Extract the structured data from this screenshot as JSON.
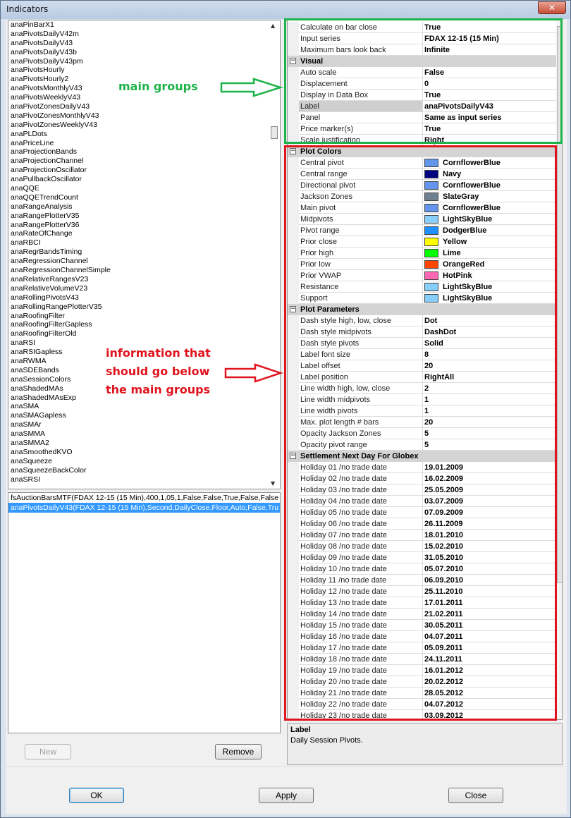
{
  "window": {
    "title": "Indicators",
    "close_glyph": "✕"
  },
  "indicator_list": [
    "anaPinBarX1",
    "anaPivotsDailyV42m",
    "anaPivotsDailyV43",
    "anaPivotsDailyV43b",
    "anaPivotsDailyV43pm",
    "anaPivotsHourly",
    "anaPivotsHourly2",
    "anaPivotsMonthlyV43",
    "anaPivotsWeeklyV43",
    "anaPivotZonesDailyV43",
    "anaPivotZonesMonthlyV43",
    "anaPivotZonesWeeklyV43",
    "anaPLDots",
    "anaPriceLine",
    "anaProjectionBands",
    "anaProjectionChannel",
    "anaProjectionOscillator",
    "anaPullbackOscillator",
    "anaQQE",
    "anaQQETrendCount",
    "anaRangeAnalysis",
    "anaRangePlotterV35",
    "anaRangePlotterV36",
    "anaRateOfChange",
    "anaRBCI",
    "anaRegrBandsTiming",
    "anaRegressionChannel",
    "anaRegressionChannelSimple",
    "anaRelativeRangesV23",
    "anaRelativeVolumeV23",
    "anaRollingPivotsV43",
    "anaRollingRangePlotterV35",
    "anaRoofingFilter",
    "anaRoofingFilterGapless",
    "anaRoofingFilterOld",
    "anaRSI",
    "anaRSIGapless",
    "anaRWMA",
    "anaSDEBands",
    "anaSessionColors",
    "anaShadedMAs",
    "anaShadedMAsExp",
    "anaSMA",
    "anaSMAGapless",
    "anaSMAr",
    "anaSMMA",
    "anaSMMA2",
    "anaSmoothedKVO",
    "anaSqueeze",
    "anaSqueezeBackColor",
    "anaSRSI"
  ],
  "applied_list": [
    {
      "text": "fsAuctionBarsMTF(FDAX 12-15 (15 Min),400,1,05,1,False,False,True,False,False",
      "selected": false
    },
    {
      "text": "anaPivotsDailyV43(FDAX 12-15 (15 Min),Second,DailyClose,Floor,Auto,False,Tru",
      "selected": true
    }
  ],
  "buttons": {
    "new": "New",
    "remove": "Remove",
    "ok": "OK",
    "apply": "Apply",
    "close": "Close"
  },
  "grid": [
    {
      "name": "Calculate on bar close",
      "value": "True"
    },
    {
      "name": "Input series",
      "value": "FDAX 12-15 (15 Min)"
    },
    {
      "name": "Maximum bars look back",
      "value": "Infinite"
    },
    {
      "category": "Visual"
    },
    {
      "name": "Auto scale",
      "value": "False"
    },
    {
      "name": "Displacement",
      "value": "0"
    },
    {
      "name": "Display in Data Box",
      "value": "True"
    },
    {
      "name": "Label",
      "value": "anaPivotsDailyV43",
      "selected": true
    },
    {
      "name": "Panel",
      "value": "Same as input series"
    },
    {
      "name": "Price marker(s)",
      "value": "True"
    },
    {
      "name": "Scale justification",
      "value": "Right"
    },
    {
      "category": "Plot Colors"
    },
    {
      "name": "Central pivot",
      "value": "CornflowerBlue",
      "color": "#6495ed"
    },
    {
      "name": "Central range",
      "value": "Navy",
      "color": "#000080"
    },
    {
      "name": "Directional pivot",
      "value": "CornflowerBlue",
      "color": "#6495ed"
    },
    {
      "name": "Jackson Zones",
      "value": "SlateGray",
      "color": "#708090"
    },
    {
      "name": "Main pivot",
      "value": "CornflowerBlue",
      "color": "#6495ed"
    },
    {
      "name": "Midpivots",
      "value": "LightSkyBlue",
      "color": "#87cefa"
    },
    {
      "name": "Pivot range",
      "value": "DodgerBlue",
      "color": "#1e90ff"
    },
    {
      "name": "Prior close",
      "value": "Yellow",
      "color": "#ffff00"
    },
    {
      "name": "Prior high",
      "value": "Lime",
      "color": "#00ff00"
    },
    {
      "name": "Prior low",
      "value": "OrangeRed",
      "color": "#ff4500"
    },
    {
      "name": "Prior VWAP",
      "value": "HotPink",
      "color": "#ff69b4"
    },
    {
      "name": "Resistance",
      "value": "LightSkyBlue",
      "color": "#87cefa"
    },
    {
      "name": "Support",
      "value": "LightSkyBlue",
      "color": "#87cefa"
    },
    {
      "category": "Plot Parameters"
    },
    {
      "name": "Dash style high, low, close",
      "value": "Dot"
    },
    {
      "name": "Dash style midpivots",
      "value": "DashDot"
    },
    {
      "name": "Dash style pivots",
      "value": "Solid"
    },
    {
      "name": "Label font size",
      "value": "8"
    },
    {
      "name": "Label offset",
      "value": "20"
    },
    {
      "name": "Label position",
      "value": "RightAll"
    },
    {
      "name": "Line width high, low, close",
      "value": "2"
    },
    {
      "name": "Line width midpivots",
      "value": "1"
    },
    {
      "name": "Line width pivots",
      "value": "1"
    },
    {
      "name": "Max. plot length # bars",
      "value": "20"
    },
    {
      "name": "Opacity Jackson Zones",
      "value": "5"
    },
    {
      "name": "Opacity pivot range",
      "value": "5"
    },
    {
      "category": "Settlement Next Day For Globex"
    },
    {
      "name": "Holiday 01 /no trade date",
      "value": "19.01.2009"
    },
    {
      "name": "Holiday 02 /no trade date",
      "value": "16.02.2009"
    },
    {
      "name": "Holiday 03 /no trade date",
      "value": "25.05.2009"
    },
    {
      "name": "Holiday 04 /no trade date",
      "value": "03.07.2009"
    },
    {
      "name": "Holiday 05 /no trade date",
      "value": "07.09.2009"
    },
    {
      "name": "Holiday 06 /no trade date",
      "value": "26.11.2009"
    },
    {
      "name": "Holiday 07 /no trade date",
      "value": "18.01.2010"
    },
    {
      "name": "Holiday 08 /no trade date",
      "value": "15.02.2010"
    },
    {
      "name": "Holiday 09 /no trade date",
      "value": "31.05.2010"
    },
    {
      "name": "Holiday 10 /no trade date",
      "value": "05.07.2010"
    },
    {
      "name": "Holiday 11 /no trade date",
      "value": "06.09.2010"
    },
    {
      "name": "Holiday 12 /no trade date",
      "value": "25.11.2010"
    },
    {
      "name": "Holiday 13 /no trade date",
      "value": "17.01.2011"
    },
    {
      "name": "Holiday 14 /no trade date",
      "value": "21.02.2011"
    },
    {
      "name": "Holiday 15 /no trade date",
      "value": "30.05.2011"
    },
    {
      "name": "Holiday 16 /no trade date",
      "value": "04.07.2011"
    },
    {
      "name": "Holiday 17 /no trade date",
      "value": "05.09.2011"
    },
    {
      "name": "Holiday 18 /no trade date",
      "value": "24.11.2011"
    },
    {
      "name": "Holiday 19 /no trade date",
      "value": "16.01.2012"
    },
    {
      "name": "Holiday 20 /no trade date",
      "value": "20.02.2012"
    },
    {
      "name": "Holiday 21 /no trade date",
      "value": "28.05.2012"
    },
    {
      "name": "Holiday 22 /no trade date",
      "value": "04.07.2012"
    },
    {
      "name": "Holiday 23 /no trade date",
      "value": "03.09.2012"
    }
  ],
  "help": {
    "title": "Label",
    "text": "Daily Session Pivots."
  },
  "annotations": {
    "green_lines": [
      "main groups"
    ],
    "red_lines": [
      "information that",
      "should go below",
      "the main groups"
    ],
    "green_color": "#1db34a",
    "red_color": "#e0141e"
  }
}
